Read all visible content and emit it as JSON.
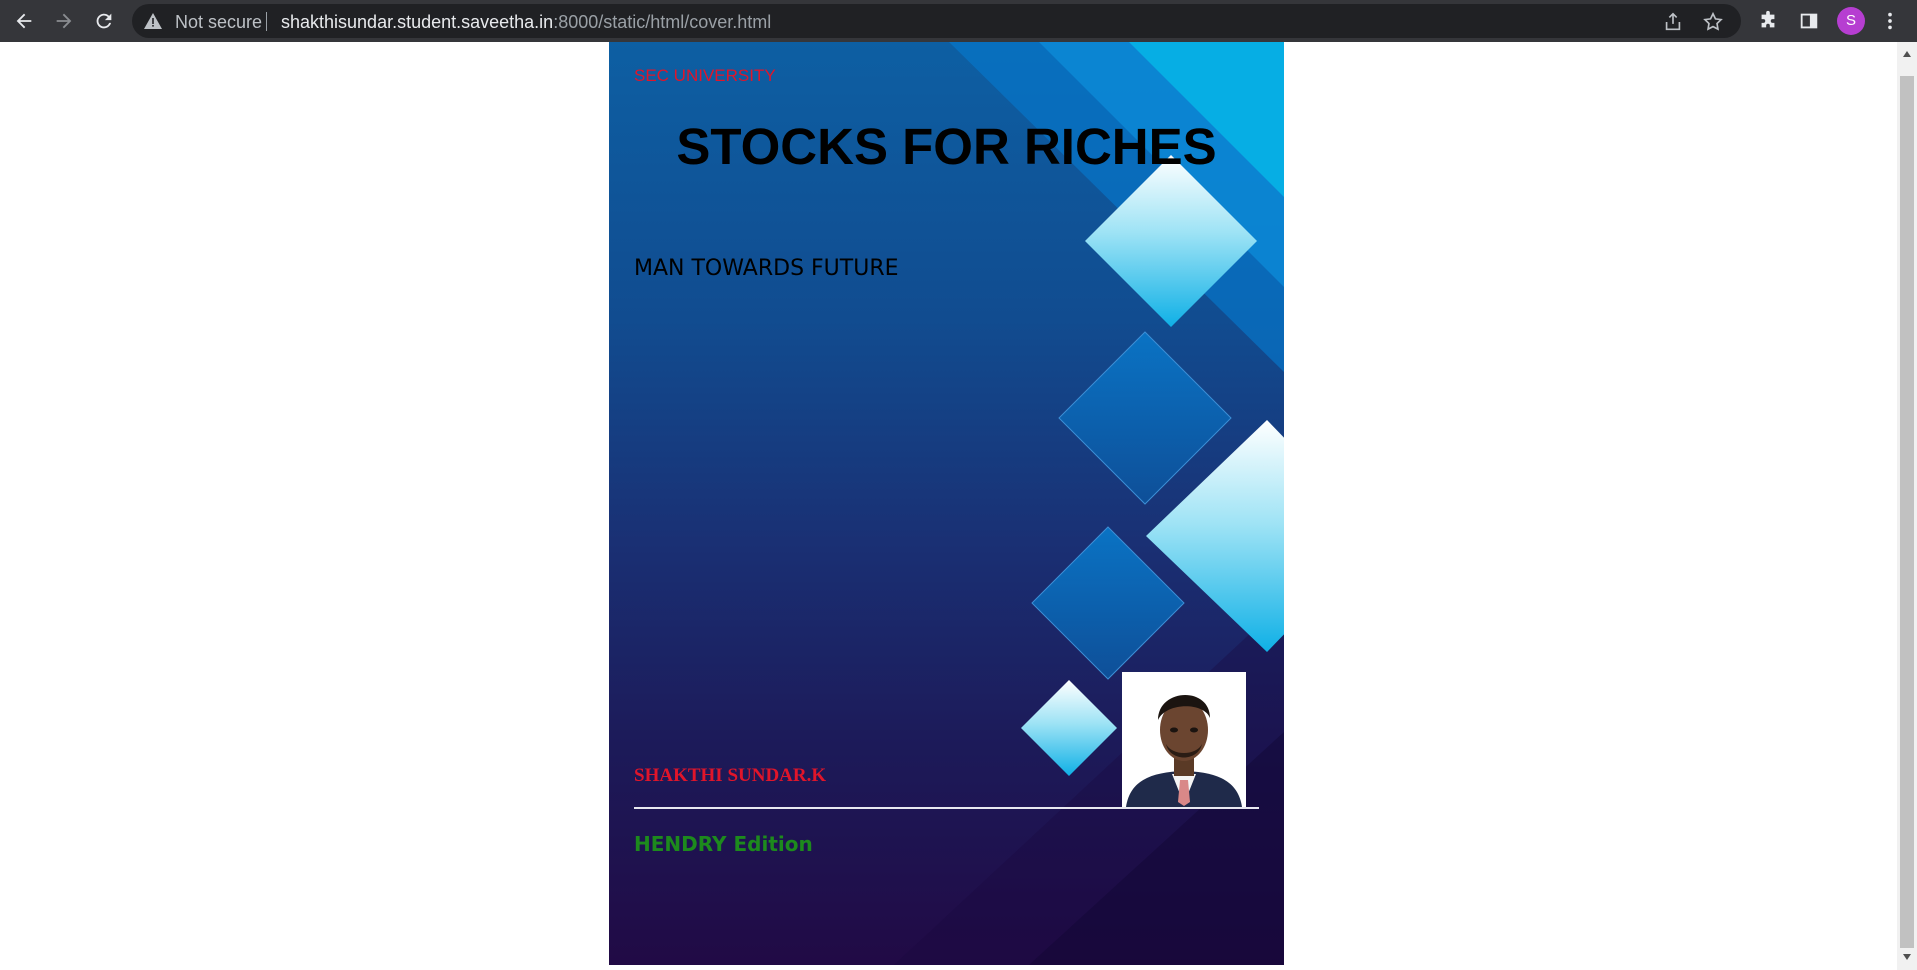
{
  "browser": {
    "security_label": "Not secure",
    "url_host": "shakthisundar.student.saveetha.in",
    "url_rest": ":8000/static/html/cover.html",
    "profile_initial": "S",
    "profile_color": "#b63ed1"
  },
  "cover": {
    "university": "SEC UNIVERSITY",
    "title": "STOCKS FOR RICHES",
    "subtitle": "MAN TOWARDS FUTURE",
    "author": "SHAKTHI SUNDAR.K",
    "edition": "HENDRY Edition",
    "colors": {
      "university": "#e0152a",
      "author": "#e0152a",
      "edition": "#1d8a1d",
      "background_top": "#0d5fa3",
      "background_bottom": "#210a45"
    }
  }
}
